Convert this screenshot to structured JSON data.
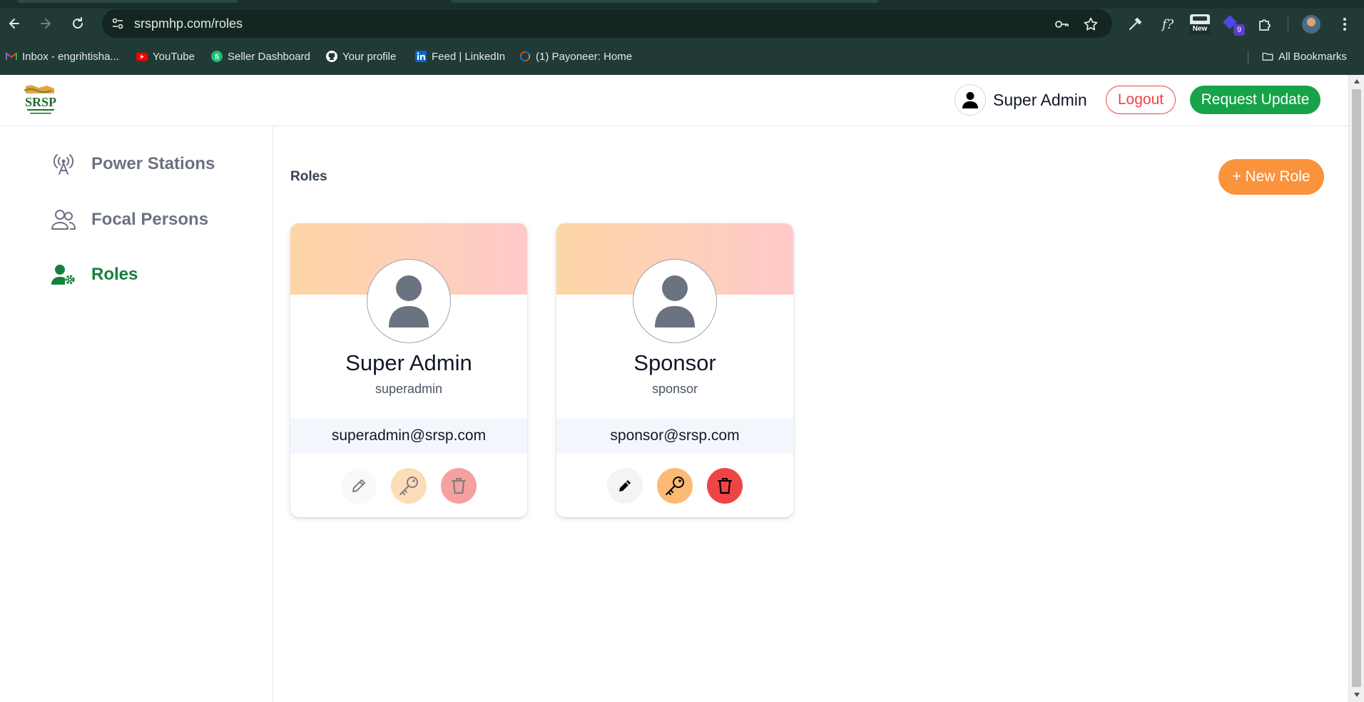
{
  "browser": {
    "url": "srspmhp.com/roles",
    "extension_badge_new": "New",
    "extension_badge_count": "9",
    "bookmarks": [
      {
        "label": "Inbox - engrihtisha...",
        "icon": "gmail-icon",
        "color": "#ea4335"
      },
      {
        "label": "YouTube",
        "icon": "youtube-icon",
        "color": "#ff0000"
      },
      {
        "label": "Seller Dashboard",
        "icon": "fiverr-icon",
        "color": "#1dbf73"
      },
      {
        "label": "Your profile",
        "icon": "github-icon",
        "color": "#ffffff"
      },
      {
        "label": "Feed | LinkedIn",
        "icon": "linkedin-icon",
        "color": "#0a66c2"
      },
      {
        "label": "(1) Payoneer: Home",
        "icon": "payoneer-icon",
        "color": "#ff4800"
      }
    ],
    "all_bookmarks": "All Bookmarks"
  },
  "header": {
    "user_name": "Super Admin",
    "logout_label": "Logout",
    "request_update_label": "Request Update"
  },
  "sidebar": {
    "items": [
      {
        "label": "Power Stations",
        "icon": "broadcast-tower-icon",
        "active": false
      },
      {
        "label": "Focal Persons",
        "icon": "users-icon",
        "active": false
      },
      {
        "label": "Roles",
        "icon": "user-gear-icon",
        "active": true
      }
    ]
  },
  "main": {
    "title": "Roles",
    "new_role_label": "+ New Role",
    "roles": [
      {
        "name": "Super Admin",
        "username": "superadmin",
        "email": "superadmin@srsp.com",
        "actions_enabled": false
      },
      {
        "name": "Sponsor",
        "username": "sponsor",
        "email": "sponsor@srsp.com",
        "actions_enabled": true
      }
    ]
  },
  "colors": {
    "accent_green": "#16a34a",
    "danger_red": "#ef4444",
    "accent_orange": "#fb923c",
    "chrome_bg": "#213a36"
  }
}
